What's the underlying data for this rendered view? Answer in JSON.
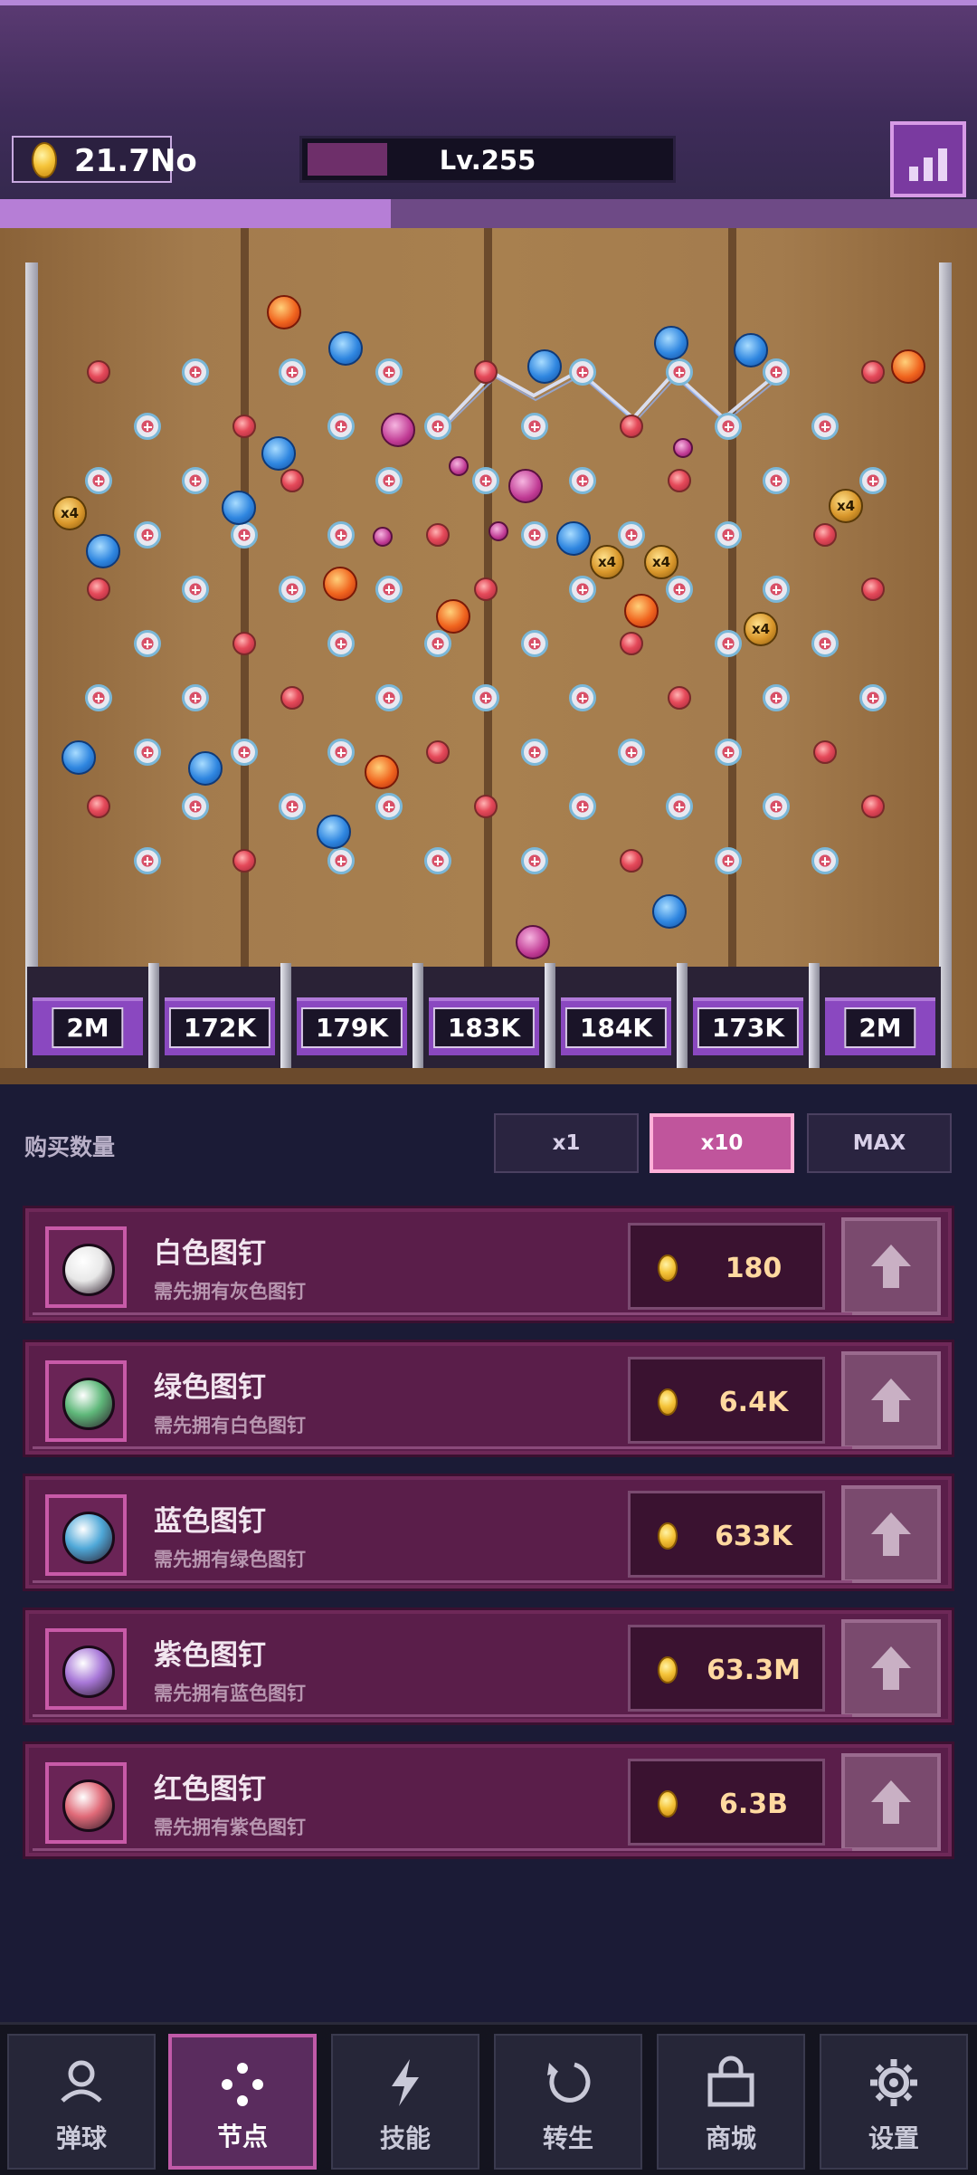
{
  "hud": {
    "currency": "21.7No",
    "level": "Lv.255",
    "level_progress": 0.22,
    "xp_progress": 0.4,
    "stats_icon": "bar-chart-icon"
  },
  "board": {
    "buckets": [
      "2M",
      "172K",
      "179K",
      "183K",
      "184K",
      "173K",
      "2M"
    ],
    "ball_multiplier_label": "x4"
  },
  "purchase": {
    "label": "购买数量",
    "options": [
      "x1",
      "x10",
      "MAX"
    ],
    "selected": "x10"
  },
  "upgrades": [
    {
      "name": "白色图钉",
      "requirement": "需先拥有灰色图钉",
      "price": "180",
      "color": "#e8e8e8"
    },
    {
      "name": "绿色图钉",
      "requirement": "需先拥有白色图钉",
      "price": "6.4K",
      "color": "#5fb87a"
    },
    {
      "name": "蓝色图钉",
      "requirement": "需先拥有绿色图钉",
      "price": "633K",
      "color": "#4fa8d8"
    },
    {
      "name": "紫色图钉",
      "requirement": "需先拥有蓝色图钉",
      "price": "63.3M",
      "color": "#a878d8"
    },
    {
      "name": "红色图钉",
      "requirement": "需先拥有紫色图钉",
      "price": "6.3B",
      "color": "#e06a78"
    }
  ],
  "nav": [
    {
      "label": "弹球",
      "icon": "ball-launch-icon"
    },
    {
      "label": "节点",
      "icon": "nodes-icon",
      "active": true
    },
    {
      "label": "技能",
      "icon": "lightning-icon"
    },
    {
      "label": "转生",
      "icon": "rebirth-icon"
    },
    {
      "label": "商城",
      "icon": "shop-bag-icon"
    },
    {
      "label": "设置",
      "icon": "gear-icon"
    }
  ]
}
